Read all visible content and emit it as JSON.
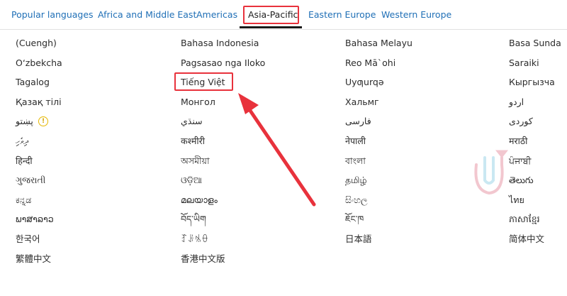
{
  "tabs": [
    {
      "label": "Popular languages"
    },
    {
      "label": "Africa and Middle East"
    },
    {
      "label": "Americas"
    },
    {
      "label": "Asia-Pacific"
    },
    {
      "label": "Eastern Europe"
    },
    {
      "label": "Western Europe"
    }
  ],
  "active_tab": "Asia-Pacific",
  "annotation_color": "#e8323c",
  "languages": [
    [
      "(Cuengh)",
      "Bahasa Indonesia",
      "Bahasa Melayu",
      "Basa Sunda"
    ],
    [
      "O‘zbekcha",
      "Pagsasao nga Iloko",
      "Reo Mā`ohi",
      "Saraiki"
    ],
    [
      "Tagalog",
      "Tiếng Việt",
      "Uyƣurqə",
      "Кыргызча"
    ],
    [
      "Қазақ тілі",
      "Монгол",
      "Хальмг",
      "اردو"
    ],
    [
      "پښتو",
      "سنڌي",
      "فارسی",
      "کوردی"
    ],
    [
      "ދިވެހި",
      "कश्मीरी",
      "नेपाली",
      "मराठी"
    ],
    [
      "हिन्दी",
      "অসমীয়া",
      "বাংলা",
      "ਪੰਜਾਬੀ"
    ],
    [
      "ગુજરાતી",
      "ଓଡ଼ିଆ",
      "தமிழ்",
      "తెలుగు"
    ],
    [
      "ಕನ್ನಡ",
      "മലയാളം",
      "සිංහල",
      "ไทย"
    ],
    [
      "ພາສາລາວ",
      "བོད་ཡིག",
      "ཇོང་ཁ",
      "ភាសាខ្មែរ"
    ],
    [
      "한국어",
      "ꆈꌠꁱꂷ",
      "日本語",
      "简体中文"
    ],
    [
      "繁體中文",
      "香港中文版",
      "",
      ""
    ]
  ],
  "highlighted_language": "Tiếng Việt",
  "warning_icon": "info-circle-icon"
}
